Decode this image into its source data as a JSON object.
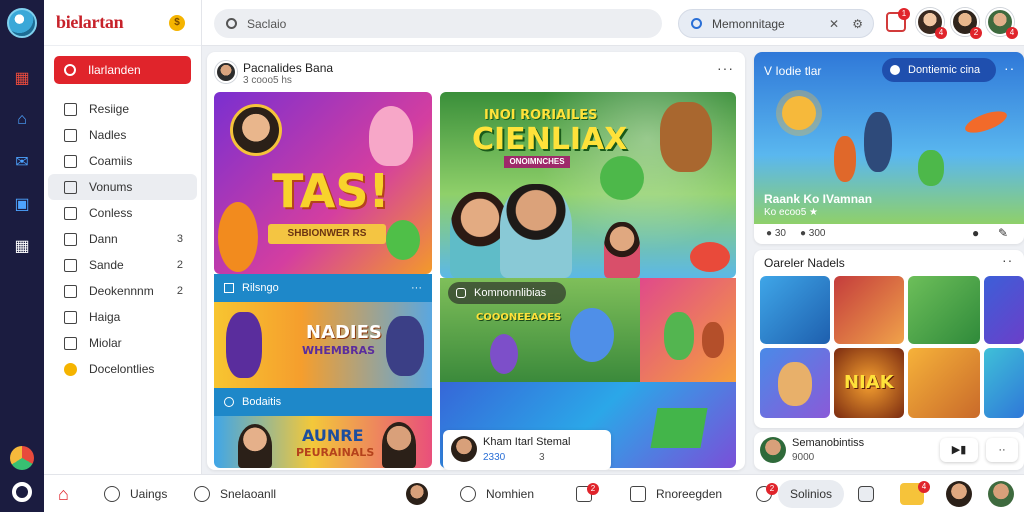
{
  "brand": {
    "name": "bielartan"
  },
  "sidebar": {
    "cta_label": "Ilarlanden",
    "items": [
      {
        "label": "Resiige",
        "count": ""
      },
      {
        "label": "Nadles",
        "count": ""
      },
      {
        "label": "Coamiis",
        "count": ""
      },
      {
        "label": "Vonums",
        "count": ""
      },
      {
        "label": "Conless",
        "count": ""
      },
      {
        "label": "Dann",
        "count": "3"
      },
      {
        "label": "Sande",
        "count": "2"
      },
      {
        "label": "Deokennnm",
        "count": "2"
      },
      {
        "label": "Haiga",
        "count": ""
      },
      {
        "label": "Miolar",
        "count": ""
      },
      {
        "label": "Docelontlies",
        "count": ""
      }
    ]
  },
  "topbar": {
    "search_placeholder": "Saclaio",
    "search2_value": "Memonnitage",
    "notif_badge": "1",
    "avatar_badges": [
      "4",
      "2",
      "4"
    ]
  },
  "feed": {
    "author": "Pacnalides Bana",
    "meta": "3 cooo5 hs",
    "tile1_title": "TAS!",
    "tile1_sub": "SHBIONWER RS",
    "row1_label": "Rilsngo",
    "tile2_title": "NADIES",
    "tile2_sub": "WHEMBRAS",
    "row2_label": "Bodaitis",
    "tile3_title": "AUNRE",
    "tile3_sub": "PEURAINALS",
    "hero_top": "INOI RORIAILES",
    "hero_title": "CIENLIAX",
    "hero_ribbon": "ONOIMNCHES",
    "center_pill": "Komnonnlibias",
    "center_band": "COOONEEAOES",
    "comment_title": "Kham Itarl Stemal",
    "comment_meta": "2330",
    "comment_count": "3"
  },
  "rightpanel": {
    "title": "V Iodie tlar",
    "button_label": "Dontiemic cina",
    "video_title": "Raank Ko IVamnan",
    "video_meta": "Ko ecoo5 ★",
    "reactions": [
      "30",
      "300"
    ],
    "section2_title": "Oareler Nadels",
    "poster_text": "NIAK",
    "footer_name": "Semanobintiss",
    "footer_meta": "9000"
  },
  "bottombar": {
    "item1": "Uaings",
    "item2": "Snelaoanll",
    "item3": "Nomhien",
    "item4": "Rnoreegden",
    "item5": "Solinios",
    "badge1": "2",
    "badge2": "2",
    "badge3": "4"
  },
  "colors": {
    "accent": "#e0242b",
    "rail": "#1b1c40",
    "link": "#2a6fd6"
  }
}
